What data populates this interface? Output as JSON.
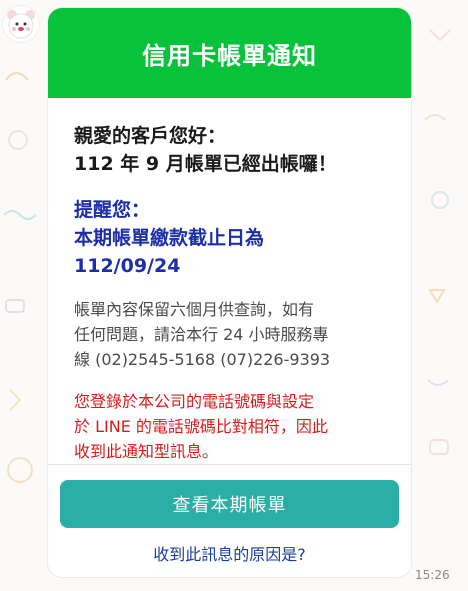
{
  "chat": {
    "sender_avatar_icon": "bear-avatar-icon",
    "timestamp": "15:26"
  },
  "message": {
    "header_title": "信用卡帳單通知",
    "header_color": "#08c23c",
    "greeting_line1": "親愛的客戶您好：",
    "greeting_line2": "112 年 9 月帳單已經出帳囉！",
    "reminder_line1": "提醒您：",
    "reminder_line2": "本期帳單繳款截止日為",
    "reminder_line3": "112/09/24",
    "info_line1": "帳單內容保留六個月供查詢，如有",
    "info_line2": "任何問題，請洽本行 24 小時服務專",
    "info_line3": "線 (02)2545-5168 (07)226-9393",
    "notice_line1": "您登錄於本公司的電話號碼與設定",
    "notice_line2": "於 LINE 的電話號碼比對相符，因此",
    "notice_line3": "收到此通知型訊息。",
    "primary_button_label": "查看本期帳單",
    "primary_button_color": "#2aaea6",
    "secondary_link_label": "收到此訊息的原因是?"
  }
}
